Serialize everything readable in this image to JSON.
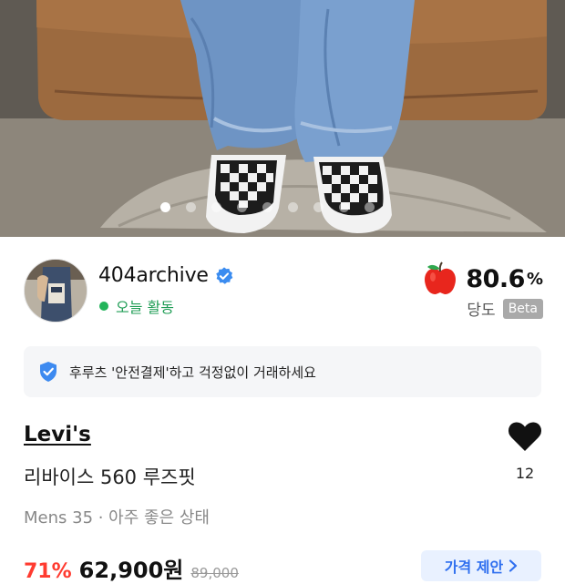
{
  "photo": {
    "description_icon": "product-photo",
    "carousel_total": 9,
    "carousel_active": 1
  },
  "seller": {
    "name": "404archive",
    "activity": "오늘 활동",
    "score_value": "80.6",
    "score_unit": "%",
    "score_label": "당도",
    "beta": "Beta"
  },
  "banner": {
    "text": "후루츠 '안전결제'하고 걱정없이 거래하세요"
  },
  "product": {
    "brand": "Levi's",
    "title": "리바이스 560 루즈핏",
    "meta": "Mens 35 · 아주 좋은 상태",
    "like_count": "12"
  },
  "price": {
    "discount": "71%",
    "price": "62,900원",
    "original": "89,000"
  },
  "actions": {
    "offer_label": "가격 제안"
  },
  "colors": {
    "accent_green": "#22b45a",
    "apple_red": "#e8261d",
    "verified_blue": "#3b8cf0",
    "discount_red": "#ff3b30",
    "offer_blue": "#2f6fef"
  }
}
